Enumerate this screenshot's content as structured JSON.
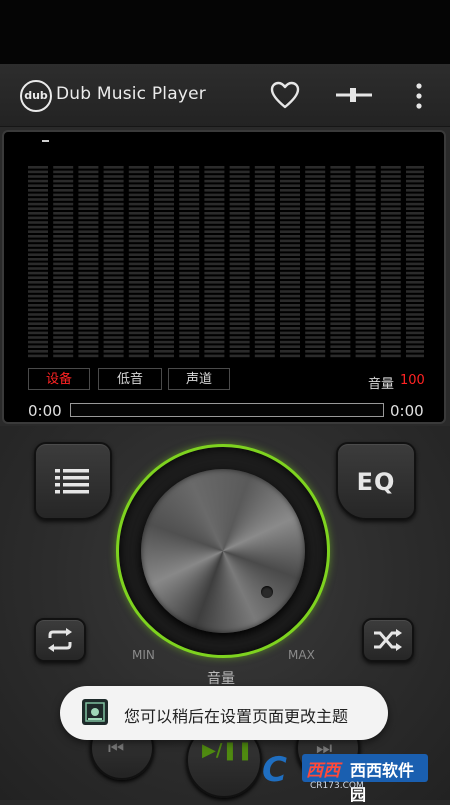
{
  "app": {
    "logo_text": "dub",
    "title": "Dub Music Player",
    "icons": [
      "heart-icon",
      "equalizer-slider-icon",
      "more-vert-icon"
    ]
  },
  "display": {
    "tabs": [
      "设备",
      "低音",
      "声道"
    ],
    "active_tab_color": "#ff2323",
    "volume_label": "音量",
    "volume_value": "100",
    "time_current": "0:00",
    "time_total": "0:00",
    "progress": 0,
    "spectrum_bars": 16
  },
  "controls": {
    "eq_label": "EQ",
    "knob_min": "MIN",
    "knob_max": "MAX",
    "knob_label": "音量",
    "ring_color": "#7ed31f",
    "buttons": [
      "playlist-icon",
      "repeat-icon",
      "shuffle-icon",
      "previous-icon",
      "play-pause-icon",
      "next-icon"
    ]
  },
  "toast": {
    "message": "您可以稍后在设置页面更改主题"
  },
  "watermark": {
    "brand": "西西软件园",
    "site": "CR173.COM"
  }
}
